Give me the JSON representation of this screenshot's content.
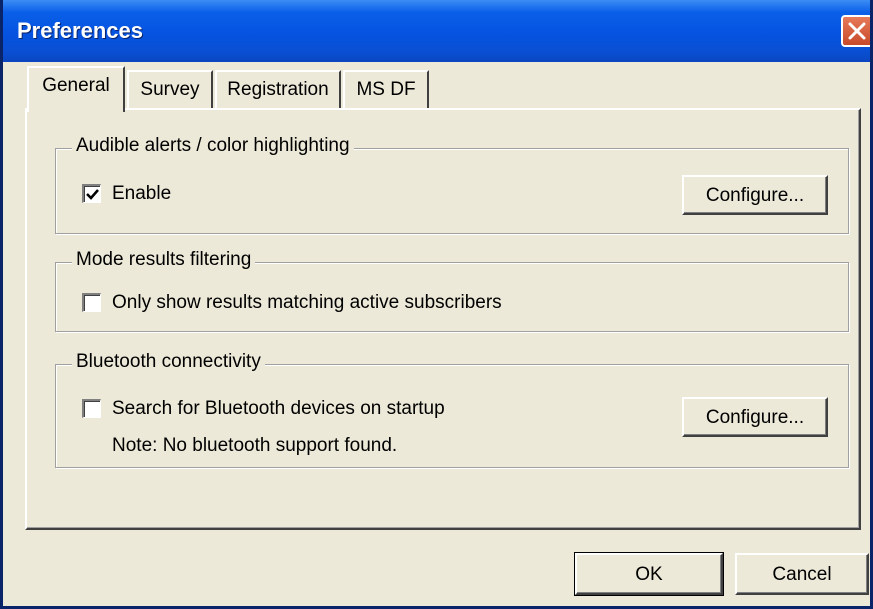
{
  "window": {
    "title": "Preferences"
  },
  "tabs": [
    {
      "label": "General",
      "active": true
    },
    {
      "label": "Survey",
      "active": false
    },
    {
      "label": "Registration",
      "active": false
    },
    {
      "label": "MS DF",
      "active": false
    }
  ],
  "groups": {
    "audible": {
      "title": "Audible alerts / color highlighting",
      "checkbox_label": "Enable",
      "checked": true,
      "configure_label": "Configure..."
    },
    "mode": {
      "title": "Mode results filtering",
      "checkbox_label": "Only show results matching active subscribers",
      "checked": false
    },
    "bluetooth": {
      "title": "Bluetooth connectivity",
      "checkbox_label": "Search for Bluetooth devices on startup",
      "checked": false,
      "note": "Note: No bluetooth support found.",
      "configure_label": "Configure..."
    }
  },
  "buttons": {
    "ok": "OK",
    "cancel": "Cancel"
  },
  "colors": {
    "titlebar": "#0553E0",
    "face": "#ECE9D8",
    "close": "#C84A2A"
  }
}
